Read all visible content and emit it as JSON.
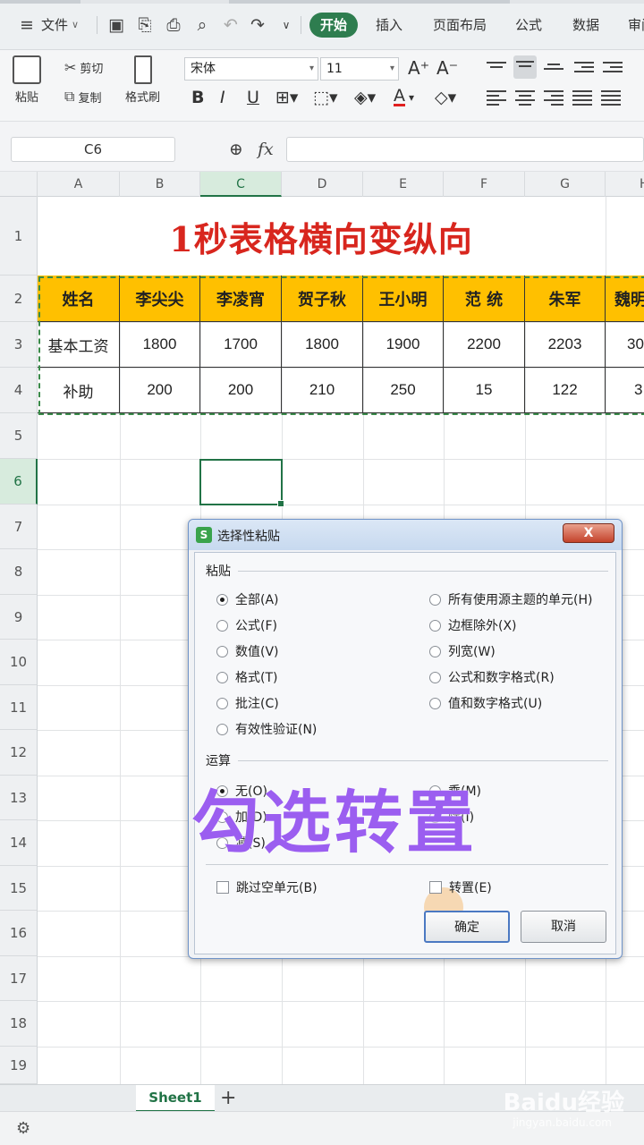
{
  "menubar": {
    "file_label": "文件",
    "tabs": [
      "开始",
      "插入",
      "页面布局",
      "公式",
      "数据",
      "审阅"
    ]
  },
  "ribbon": {
    "paste": "粘贴",
    "cut": "剪切",
    "copy": "复制",
    "format_painter": "格式刷",
    "font_name": "宋体",
    "font_size": "11"
  },
  "formula_bar": {
    "cell_ref": "C6",
    "fx": "fx",
    "value": ""
  },
  "sheet": {
    "columns": [
      "A",
      "B",
      "C",
      "D",
      "E",
      "F",
      "G",
      "H"
    ],
    "rows": [
      "1",
      "2",
      "3",
      "4",
      "5",
      "6",
      "7",
      "8",
      "9",
      "10",
      "11",
      "12",
      "13",
      "14",
      "15",
      "16",
      "17",
      "18",
      "19"
    ],
    "title": "1秒表格横向变纵向",
    "header_row": [
      "姓名",
      "李尖尖",
      "李凌宵",
      "贺子秋",
      "王小明",
      "范 统",
      "朱军",
      "魏明"
    ],
    "row3": [
      "基本工资",
      "1800",
      "1700",
      "1800",
      "1900",
      "2200",
      "2203",
      "30"
    ],
    "row4": [
      "补助",
      "200",
      "200",
      "210",
      "250",
      "15",
      "122",
      "3"
    ],
    "selected_column": "C",
    "selected_row": "6"
  },
  "sheet_tabs": [
    "Sheet1"
  ],
  "dialog": {
    "title": "选择性粘贴",
    "close": "X",
    "paste_group": "粘贴",
    "paste_options_left": [
      {
        "label": "全部(A)",
        "selected": true
      },
      {
        "label": "公式(F)",
        "selected": false
      },
      {
        "label": "数值(V)",
        "selected": false
      },
      {
        "label": "格式(T)",
        "selected": false
      },
      {
        "label": "批注(C)",
        "selected": false
      },
      {
        "label": "有效性验证(N)",
        "selected": false
      }
    ],
    "paste_options_right": [
      {
        "label": "所有使用源主题的单元(H)",
        "selected": false
      },
      {
        "label": "边框除外(X)",
        "selected": false
      },
      {
        "label": "列宽(W)",
        "selected": false
      },
      {
        "label": "公式和数字格式(R)",
        "selected": false
      },
      {
        "label": "值和数字格式(U)",
        "selected": false
      }
    ],
    "operation_group": "运算",
    "operation_left": [
      "无(O)",
      "加(D)",
      "减(S)"
    ],
    "operation_right": [
      "乘(M)",
      "除(I)"
    ],
    "skip_blanks": "跳过空单元(B)",
    "transpose": "转置(E)",
    "ok": "确定",
    "cancel": "取消"
  },
  "overlay_caption": "勾选转置",
  "watermark": {
    "brand": "Baidu经验",
    "url": "jingyan.baidu.com"
  }
}
